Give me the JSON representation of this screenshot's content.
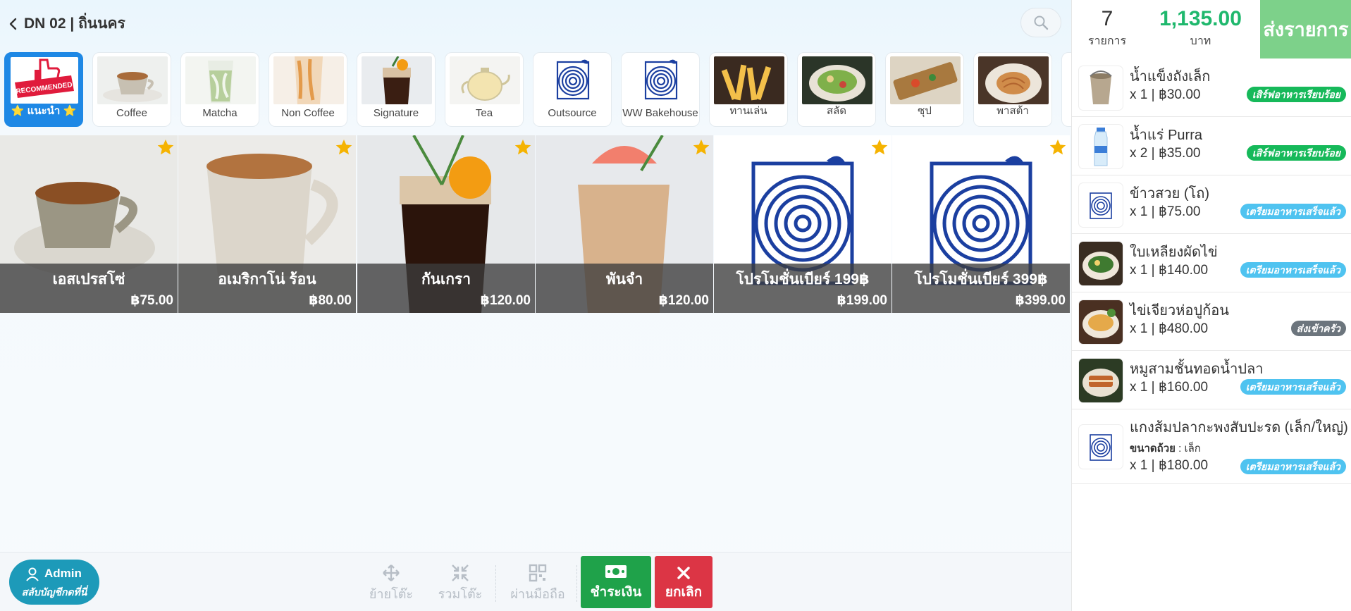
{
  "header": {
    "table_title": "DN 02 | ถิ่นนคร"
  },
  "categories": [
    {
      "label": "⭐ แนะนำ ⭐",
      "icon": "recommended-thumbs-up-icon",
      "active": true
    },
    {
      "label": "Coffee",
      "icon": "coffee-cup-photo"
    },
    {
      "label": "Matcha",
      "icon": "matcha-drink-photo"
    },
    {
      "label": "Non Coffee",
      "icon": "non-coffee-drink-photo"
    },
    {
      "label": "Signature",
      "icon": "signature-drink-photo"
    },
    {
      "label": "Tea",
      "icon": "teapot-photo"
    },
    {
      "label": "Outsource",
      "icon": "tree-ring-logo-icon"
    },
    {
      "label": "WW Bakehouse",
      "icon": "tree-ring-logo-icon"
    },
    {
      "label": "ทานเล่น",
      "icon": "fries-photo"
    },
    {
      "label": "สลัด",
      "icon": "salad-photo"
    },
    {
      "label": "ซุป",
      "icon": "soup-photo"
    },
    {
      "label": "พาสต้า",
      "icon": "pasta-photo"
    }
  ],
  "products": [
    {
      "name": "เอสเปรสโซ่",
      "price": "฿75.00",
      "image": "espresso-cup-photo"
    },
    {
      "name": "อเมริกาโน่ ร้อน",
      "price": "฿80.00",
      "image": "hot-americano-cup-photo"
    },
    {
      "name": "กันเกรา",
      "price": "฿120.00",
      "image": "iced-orange-coffee-photo"
    },
    {
      "name": "พันจำ",
      "price": "฿120.00",
      "image": "grapefruit-drink-photo"
    },
    {
      "name": "โปรโมชั่นเบียร์ 199฿",
      "price": "฿199.00",
      "image": "tree-ring-logo-icon"
    },
    {
      "name": "โปรโมชั่นเบียร์ 399฿",
      "price": "฿399.00",
      "image": "tree-ring-logo-icon"
    }
  ],
  "bottombar": {
    "admin_name": "Admin",
    "admin_sub": "สลับบัญชีกดที่นี่",
    "move_table": "ย้ายโต๊ะ",
    "merge_table": "รวมโต๊ะ",
    "via_phone": "ผ่านมือถือ",
    "pay": "ชำระเงิน",
    "cancel": "ยกเลิก"
  },
  "summary": {
    "count": "7",
    "count_unit": "รายการ",
    "total": "1,135.00",
    "total_unit": "บาท",
    "send_label": "ส่งรายการ"
  },
  "orders": [
    {
      "name": "น้ำแข็งถังเล็ก",
      "qty": "x 1 | ฿30.00",
      "status": "เสิร์ฟอาหารเรียบร้อย",
      "status_type": "served",
      "image": "ice-bucket-photo"
    },
    {
      "name": "น้ำแร่ Purra",
      "qty": "x 2 | ฿35.00",
      "status": "เสิร์ฟอาหารเรียบร้อย",
      "status_type": "served",
      "image": "water-bottle-photo"
    },
    {
      "name": "ข้าวสวย (โถ)",
      "qty": "x 1 | ฿75.00",
      "status": "เตรียมอาหารเสร็จแล้ว",
      "status_type": "ready",
      "image": "tree-ring-logo-icon"
    },
    {
      "name": "ใบเหลียงผัดไข่",
      "qty": "x 1 | ฿140.00",
      "status": "เตรียมอาหารเสร็จแล้ว",
      "status_type": "ready",
      "image": "stir-fried-greens-photo"
    },
    {
      "name": "ไข่เจียวห่อปูก้อน",
      "qty": "x 1 | ฿480.00",
      "status": "ส่งเข้าครัว",
      "status_type": "kitchen",
      "image": "crab-omelette-photo"
    },
    {
      "name": "หมูสามชั้นทอดน้ำปลา",
      "qty": "x 1 | ฿160.00",
      "status": "เตรียมอาหารเสร็จแล้ว",
      "status_type": "ready",
      "image": "fried-pork-belly-photo"
    },
    {
      "name": "แกงส้มปลากะพงสับปะรด (เล็ก/ใหญ่)",
      "option_label": "ขนาดถ้วย",
      "option_value": " : เล็ก",
      "qty": "x 1 | ฿180.00",
      "status": "เตรียมอาหารเสร็จแล้ว",
      "status_type": "ready",
      "image": "tree-ring-logo-icon"
    }
  ],
  "colors": {
    "accent_blue": "#1e88e5",
    "pay_green": "#1fa24a",
    "cancel_red": "#dc3545",
    "total_green": "#1fb86d",
    "send_green": "#7dd18a",
    "logo_blue": "#1b3fa0",
    "star_gold": "#f5b301"
  }
}
